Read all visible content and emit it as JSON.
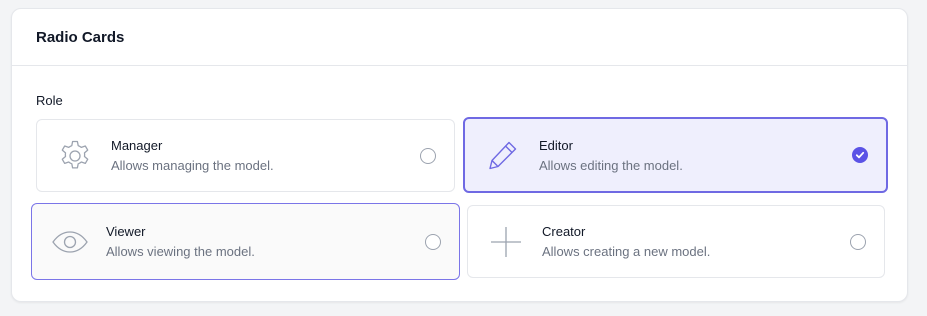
{
  "panel": {
    "title": "Radio Cards"
  },
  "form": {
    "role_label": "Role"
  },
  "cards": [
    {
      "icon": "gear-icon",
      "title": "Manager",
      "description": "Allows managing the model.",
      "checked": false
    },
    {
      "icon": "pencil-icon",
      "title": "Editor",
      "description": "Allows editing the model.",
      "checked": true
    },
    {
      "icon": "eye-icon",
      "title": "Viewer",
      "description": "Allows viewing the model.",
      "checked": false
    },
    {
      "icon": "plus-icon",
      "title": "Creator",
      "description": "Allows creating a new model.",
      "checked": false
    }
  ],
  "colors": {
    "accent": "#5b53e6",
    "selected_bg": "#efeffd",
    "icon_gray": "#9ca3af"
  }
}
